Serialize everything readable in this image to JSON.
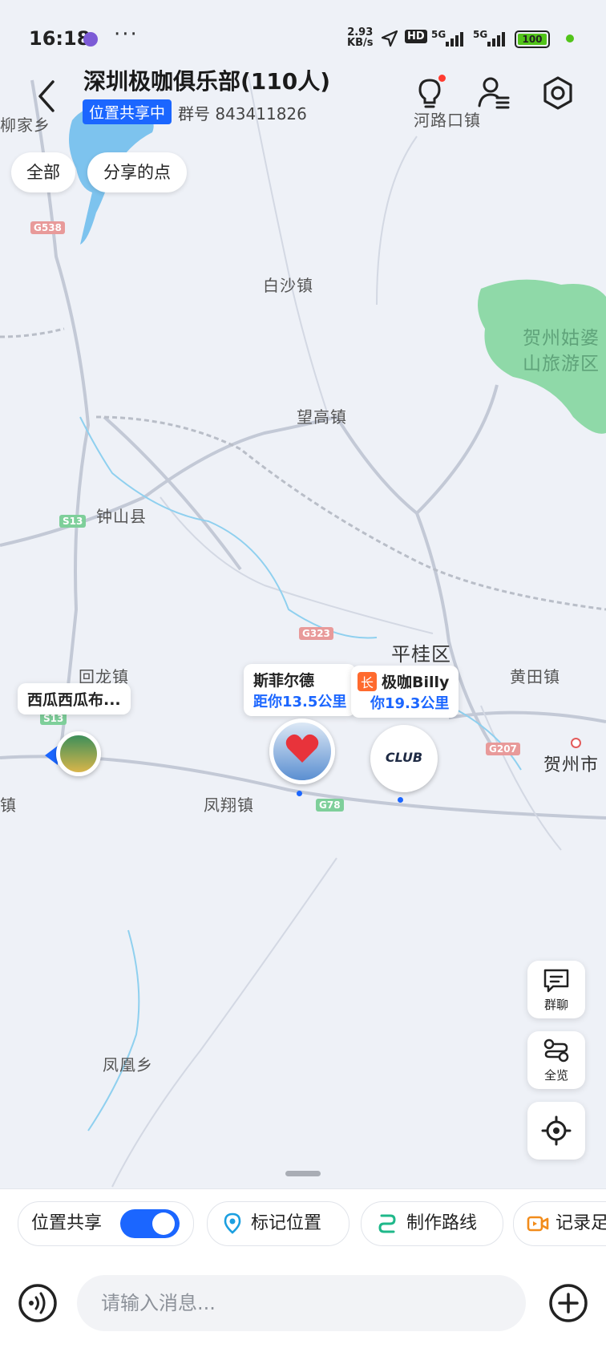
{
  "status_bar": {
    "time": "16:18",
    "more": "···",
    "speed_value": "2.93",
    "speed_unit": "KB/s",
    "hd": "HD",
    "sig1": "5G",
    "sig2": "5G",
    "battery": "100"
  },
  "header": {
    "title": "深圳极咖俱乐部(110人)",
    "share_badge": "位置共享中",
    "group_number_label": "群号 843411826"
  },
  "filters": [
    "全部",
    "分享的点"
  ],
  "map": {
    "places": [
      "柳家乡",
      "河路口镇",
      "白沙镇",
      "贺州姑婆",
      "山旅游区",
      "望高镇",
      "钟山县",
      "平桂区",
      "回龙镇",
      "黄田镇",
      "贺州市",
      "凤翔镇",
      "凤凰乡",
      "镇"
    ],
    "roads": [
      "G538",
      "S13",
      "G323",
      "G207",
      "G78",
      "S13"
    ]
  },
  "members": [
    {
      "name": "西瓜西瓜布..."
    },
    {
      "name": "斯菲尔德",
      "distance": "距你13.5公里"
    },
    {
      "role": "长",
      "name": "极咖Billy",
      "distance": "你19.3公里"
    }
  ],
  "club_logo_text": "CLUB",
  "tools": {
    "chat": "群聊",
    "overview": "全览"
  },
  "bottom": {
    "location_share": "位置共享",
    "location_share_on": true,
    "mark_location": "标记位置",
    "make_route": "制作路线",
    "record": "记录足",
    "message_placeholder": "请输入消息..."
  },
  "colors": {
    "accent": "#1b66ff",
    "park": "#8fd9a8",
    "water": "#7dc3ee",
    "road_badge": "#e89a9a"
  }
}
